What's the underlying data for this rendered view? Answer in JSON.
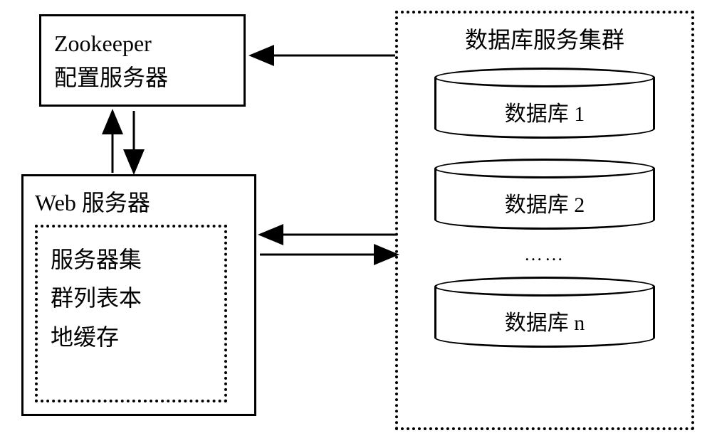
{
  "zookeeper": {
    "line1": "Zookeeper",
    "line2": "配置服务器"
  },
  "web_server": {
    "title": "Web 服务器",
    "cache": {
      "line1": "服务器集",
      "line2": "群列表本",
      "line3": "地缓存"
    }
  },
  "cluster": {
    "title": "数据库服务集群",
    "db1": "数据库 1",
    "db2": "数据库 2",
    "ellipsis": "……",
    "dbn": "数据库 n"
  }
}
